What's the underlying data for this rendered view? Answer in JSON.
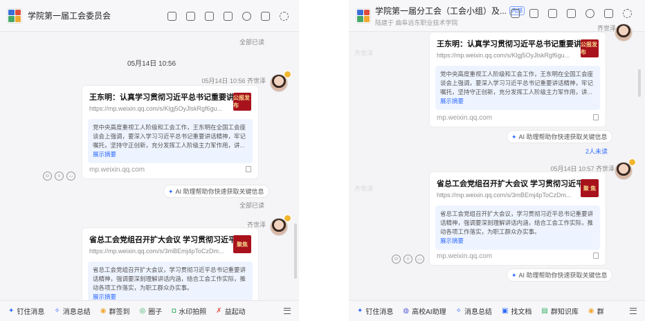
{
  "left": {
    "header": {
      "title": "学院第一届工会委员会"
    },
    "toolbar_icons": [
      "video-icon",
      "checklist-icon",
      "speaker-icon",
      "folder-icon",
      "add-user-icon",
      "search-list-icon",
      "gear-icon"
    ],
    "all_read_top": "全部已读",
    "date_divider": "05月14日 10:56",
    "msg1": {
      "meta": "05月14日 10:56  齐世泽",
      "title": "王东明：认真学习贯彻习近平总书记重要讲...",
      "url": "https://mp.weixin.qq.com/s/Klgj5OyJlskRgf6gu...",
      "thumb_text": "公报发布",
      "summary": "党中央高度重视工人阶级和工会工作，王东明在全国工会座谈会上强调，要深入学习习近平总书记重要讲话精神，牢记嘱托，坚持守正创新，充分发挥工人阶级主力军作用，讲...",
      "show_summary": "展示摘要",
      "domain": "mp.weixin.qq.com"
    },
    "ai_hint": "AI 助理帮助你快速获取关键信息",
    "all_read_mid": "全部已读",
    "msg2": {
      "meta": "齐世泽",
      "title": "省总工会党组召开扩大会议 学习贯彻习近平...",
      "url": "https://mp.weixin.qq.com/s/3mBEmj4pToCzDm...",
      "thumb_text": "聚焦",
      "summary": "省总工会党组召开扩大会议，学习贯彻习近平总书记重要讲话精神，强调要深刻理解讲话内涵，结合工会工作实际，推动各项工作落实，为职工群众办实事。",
      "show_summary": "展示摘要"
    },
    "bottom": [
      "钉住消息",
      "消息总结",
      "群签到",
      "圈子",
      "水印拍照",
      "益起动"
    ],
    "watermark": "齐世泽"
  },
  "right": {
    "header": {
      "title": "学院第一届分工会（工会小组）及...",
      "tag": "内部",
      "subtitle": "陆建于 曲阜远东职业技术学院"
    },
    "toolbar_icons": [
      "video-icon",
      "checklist-icon",
      "speaker-icon",
      "folder-icon",
      "add-user-icon",
      "search-list-icon",
      "gear-icon"
    ],
    "top_sender": "齐世泽",
    "msg1": {
      "title": "王东明：认真学习贯彻习近平总书记重要讲...",
      "url": "https://mp.weixin.qq.com/s/Klgj5OyJlskRgf6gu...",
      "thumb_text": "公报发布",
      "summary": "党中央高度重视工人阶级和工会工作，王东明在全国工会座谈会上强调，要深入学习习近平总书记重要讲话精神，牢记嘱托，坚持守正创新，充分发挥工人阶级主力军作用，讲...",
      "show_summary": "展示摘要",
      "domain": "mp.weixin.qq.com"
    },
    "ai_hint_1": "AI 助理帮助你快速获取关键信息",
    "unread": "2人未读",
    "msg2": {
      "meta": "05月14日 10:57  齐世泽",
      "title": "省总工会党组召开扩大会议 学习贯彻习近平...",
      "url": "https://mp.weixin.qq.com/s/3mBEmj4pToCzDm...",
      "thumb_text": "聚 焦",
      "summary": "省总工会党组召开扩大会议，学习贯彻习近平总书记重要讲话精神，强调要深刻理解讲话内涵，结合工会工作实际，推动各项工作落实，为职工群众办实事。",
      "show_summary": "展示摘要",
      "domain": "mp.weixin.qq.com"
    },
    "ai_hint_2": "AI 助理帮助你快速获取关键信息",
    "bottom": [
      "钉住消息",
      "高校AI助理",
      "消息总结",
      "找文档",
      "群知识库",
      "群"
    ],
    "watermark": "齐世泽"
  },
  "colors": {
    "accent": "#2f6bff",
    "summary_bg": "#eef4ff",
    "thumb_red": "#a8121c",
    "badge": "#f2b632"
  }
}
